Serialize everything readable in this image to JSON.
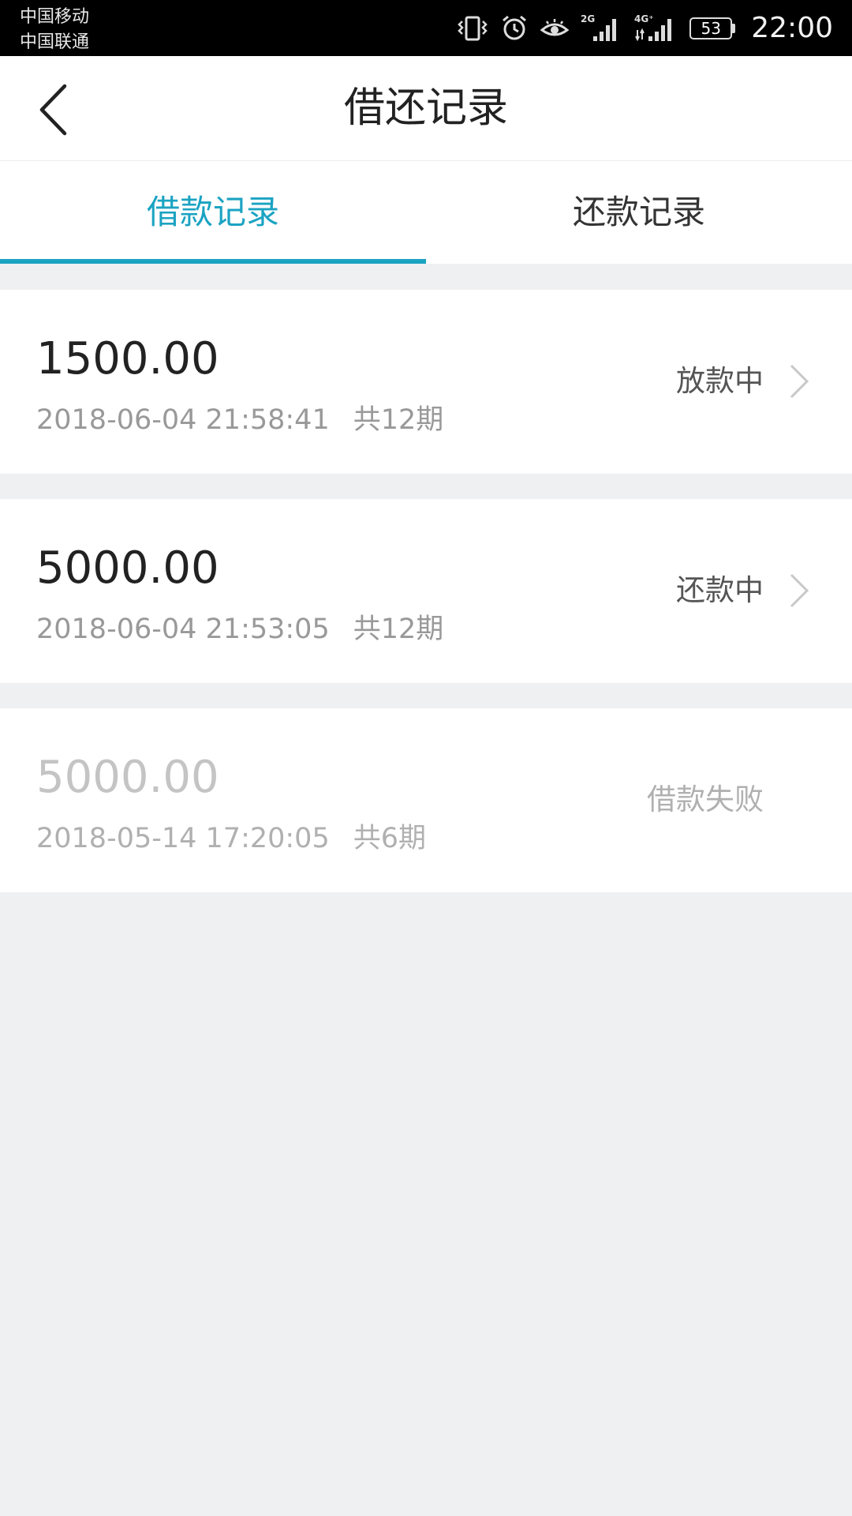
{
  "status_bar": {
    "carrier_1": "中国移动",
    "carrier_2": "中国联通",
    "network_1": "2G",
    "network_2": "4G⁺",
    "battery": "53",
    "time": "22:00",
    "icons": [
      "vibrate-icon",
      "alarm-icon",
      "eye-comfort-icon",
      "signal-icon",
      "signal-icon",
      "battery-icon"
    ]
  },
  "header": {
    "title": "借还记录",
    "back_icon": "chevron-left-icon"
  },
  "tabs": [
    {
      "label": "借款记录",
      "active": true
    },
    {
      "label": "还款记录",
      "active": false
    }
  ],
  "colors": {
    "accent": "#1ba3c2",
    "background": "#eff0f2"
  },
  "records": [
    {
      "amount": "1500.00",
      "datetime": "2018-06-04 21:58:41",
      "periods": "共12期",
      "status": "放款中",
      "has_chevron": true
    },
    {
      "amount": "5000.00",
      "datetime": "2018-06-04 21:53:05",
      "periods": "共12期",
      "status": "还款中",
      "has_chevron": true
    },
    {
      "amount": "5000.00",
      "datetime": "2018-05-14 17:20:05",
      "periods": "共6期",
      "status": "借款失败",
      "has_chevron": false
    }
  ]
}
